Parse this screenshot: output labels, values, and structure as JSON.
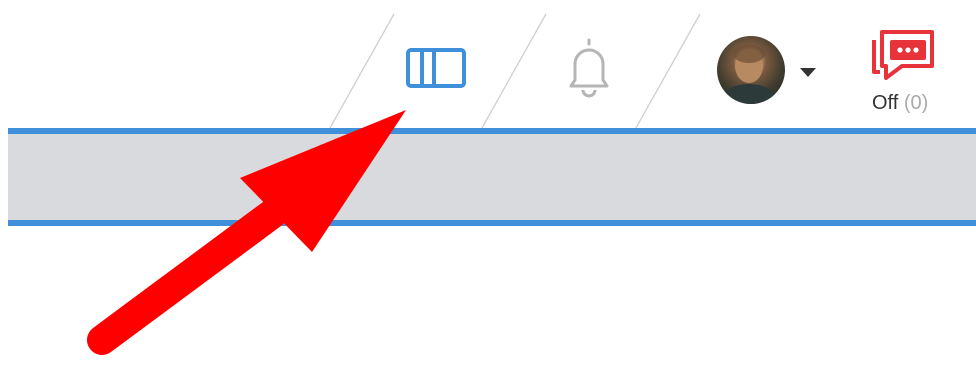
{
  "header": {
    "icons": {
      "columns": "columns-layout-icon",
      "notifications": "bell-icon",
      "avatar": "user-avatar",
      "dropdown": "caret-down-icon",
      "chat": "chat-bubble-icon"
    },
    "chat": {
      "status_label": "Off",
      "count_label": "(0)"
    }
  },
  "colors": {
    "accent_blue": "#3f8fdb",
    "band_gray": "#d9dadd",
    "chat_red": "#e8333b",
    "annotation_red": "#ff0000",
    "icon_gray": "#b5b5b5"
  },
  "annotation": {
    "type": "arrow",
    "points_to": "columns-layout-icon"
  }
}
